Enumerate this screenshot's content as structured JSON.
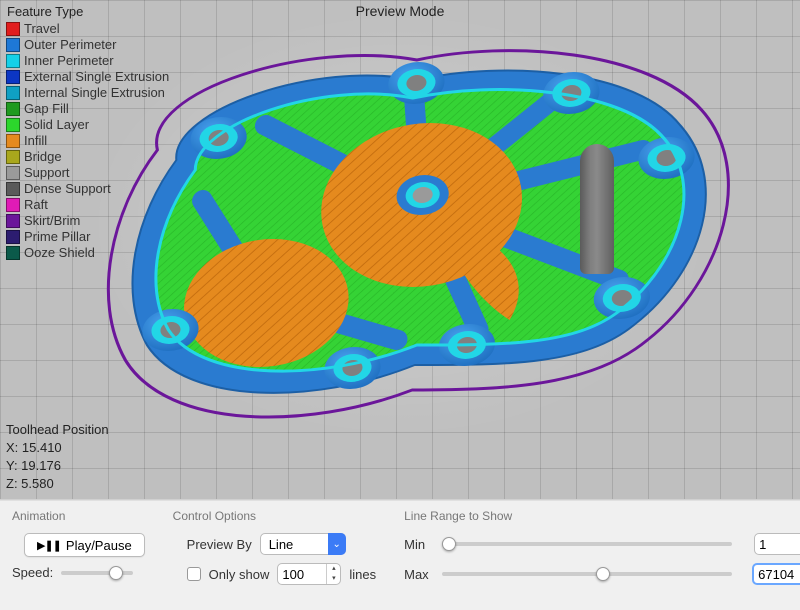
{
  "header": {
    "title": "Preview Mode"
  },
  "legend": {
    "title": "Feature Type",
    "items": [
      {
        "label": "Travel",
        "color": "#e11d1d"
      },
      {
        "label": "Outer Perimeter",
        "color": "#1e78d6"
      },
      {
        "label": "Inner Perimeter",
        "color": "#14d0e8"
      },
      {
        "label": "External Single Extrusion",
        "color": "#0c36c4"
      },
      {
        "label": "Internal Single Extrusion",
        "color": "#0fa0c4"
      },
      {
        "label": "Gap Fill",
        "color": "#1f9a1f"
      },
      {
        "label": "Solid Layer",
        "color": "#2cd62c"
      },
      {
        "label": "Infill",
        "color": "#e58a1e"
      },
      {
        "label": "Bridge",
        "color": "#a9a71c"
      },
      {
        "label": "Support",
        "color": "#9a9a9a"
      },
      {
        "label": "Dense Support",
        "color": "#5a5a5a"
      },
      {
        "label": "Raft",
        "color": "#e01bb6"
      },
      {
        "label": "Skirt/Brim",
        "color": "#6b169a"
      },
      {
        "label": "Prime Pillar",
        "color": "#2c1c70"
      },
      {
        "label": "Ooze Shield",
        "color": "#0b5a4a"
      }
    ]
  },
  "toolhead": {
    "title": "Toolhead Position",
    "x_label": "X: 15.410",
    "y_label": "Y: 19.176",
    "z_label": "Z: 5.580"
  },
  "panel": {
    "animation": {
      "title": "Animation",
      "play_pause_label": "Play/Pause",
      "speed_label": "Speed:",
      "speed_value": "82"
    },
    "control": {
      "title": "Control Options",
      "preview_by_label": "Preview By",
      "preview_by_value": "Line",
      "only_show_label": "Only show",
      "only_show_value": "100",
      "only_show_suffix": "lines",
      "only_show_checked": false
    },
    "range": {
      "title": "Line Range to Show",
      "min_label": "Min",
      "max_label": "Max",
      "min_value": "1",
      "max_value": "67104",
      "slider_min": "1",
      "slider_max": "120000",
      "slider_max_current": "67104"
    }
  },
  "colors": {
    "accent": "#3b7bf6",
    "outer_perimeter": "#2a7bd0",
    "inner_perimeter": "#22d6e6",
    "solid_layer": "#35d335",
    "infill": "#e58a1e",
    "skirt": "#6b169a",
    "support": "#6a6a6a"
  }
}
